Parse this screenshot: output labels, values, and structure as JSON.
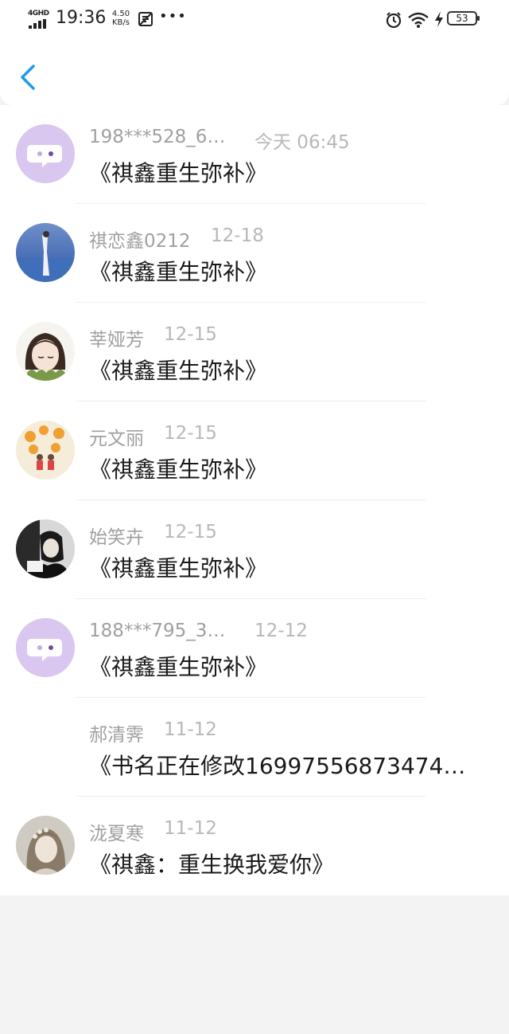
{
  "status_bar": {
    "network": "4GHD",
    "time": "19:36",
    "speed_value": "4.50",
    "speed_unit": "KB/s",
    "battery": "53"
  },
  "icons": {
    "back": "back-chevron-icon",
    "alarm": "alarm-icon",
    "wifi": "wifi-icon",
    "charging": "charging-icon"
  },
  "colors": {
    "accent": "#1e9be8",
    "name_text": "#a0a0a0",
    "message_text": "#1a1a1a",
    "default_avatar": "#d9c7ef"
  },
  "messages": [
    {
      "name": "198***528_6…",
      "date": "今天 06:45",
      "text": "《祺鑫重生弥补》",
      "avatar": "default-chat-avatar"
    },
    {
      "name": "祺恋鑫0212",
      "date": "12-18",
      "text": "《祺鑫重生弥补》",
      "avatar": "photo-avatar"
    },
    {
      "name": "莘娅芳",
      "date": "12-15",
      "text": "《祺鑫重生弥补》",
      "avatar": "photo-avatar"
    },
    {
      "name": "元文丽",
      "date": "12-15",
      "text": "《祺鑫重生弥补》",
      "avatar": "photo-avatar"
    },
    {
      "name": "始笑卉",
      "date": "12-15",
      "text": "《祺鑫重生弥补》",
      "avatar": "photo-avatar"
    },
    {
      "name": "188***795_3…",
      "date": "12-12",
      "text": "《祺鑫重生弥补》",
      "avatar": "default-chat-avatar"
    },
    {
      "name": "郝清霁",
      "date": "11-12",
      "text": "《书名正在修改16997556873474…",
      "avatar": "none"
    },
    {
      "name": "泷夏寒",
      "date": "11-12",
      "text": "《祺鑫：重生换我爱你》",
      "avatar": "photo-avatar"
    }
  ]
}
